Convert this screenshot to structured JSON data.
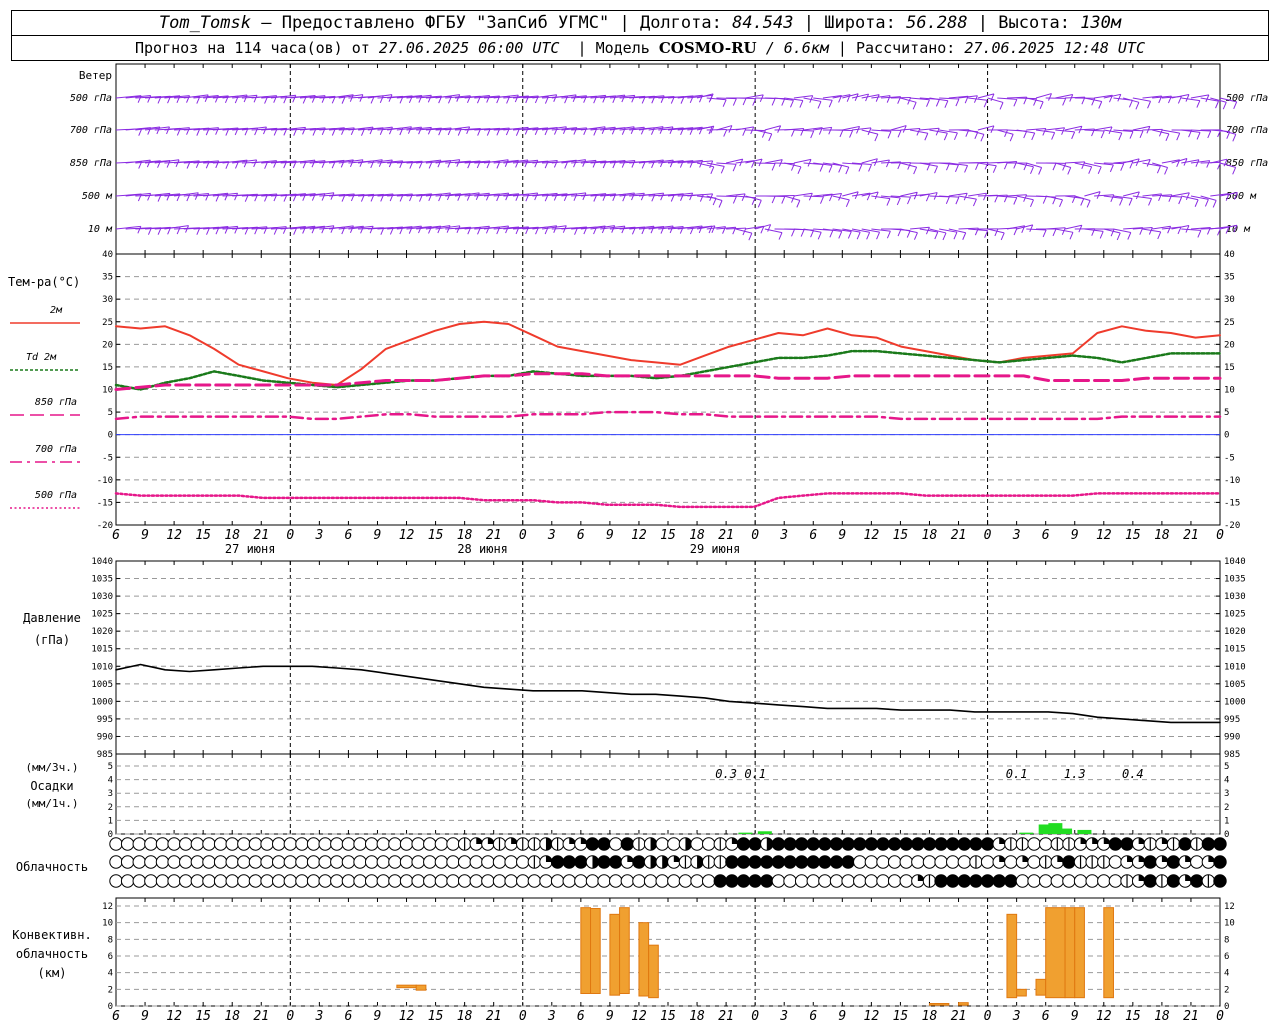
{
  "header": {
    "station": "Tom_Tomsk",
    "provider": "– Предоставлено ФГБУ \"ЗапСиб УГМС\"",
    "lon_label": "Долгота:",
    "lon": "84.543",
    "lat_label": "Широта:",
    "lat": "56.288",
    "alt_label": "Высота:",
    "alt": "130м",
    "forecast_prefix": "Прогноз на 114 часа(ов)  от",
    "issue_time": "27.06.2025 06:00 UTC",
    "model_label": "Модель",
    "model": "COSMO-RU",
    "resolution": "/ 6.6км",
    "calc_label": "Рассчитано:",
    "calc_time": "27.06.2025 12:48 UTC"
  },
  "chart_data": [
    {
      "type": "wind-barbs",
      "title": "Ветер",
      "levels": [
        "500 гПа",
        "700 гПа",
        "850 гПа",
        "500 м",
        "10  м"
      ],
      "color": "#8a2be2"
    },
    {
      "type": "line",
      "title": "Тем-ра(°С)",
      "ylim": [
        -20,
        40
      ],
      "yticks": [
        -20,
        -15,
        -10,
        -5,
        0,
        5,
        10,
        15,
        20,
        25,
        30,
        35,
        40
      ],
      "x_hours": [
        0,
        3,
        6,
        9,
        12,
        15,
        18,
        21,
        24,
        27,
        30,
        33,
        36,
        39,
        42,
        45,
        48,
        51,
        54,
        57,
        60,
        63,
        66,
        69,
        72,
        75,
        78,
        81,
        84,
        87,
        90,
        93,
        96,
        99,
        102,
        105,
        108,
        111,
        114
      ],
      "series": [
        {
          "name": "2м",
          "color": "#ef3b2c",
          "style": "solid",
          "values": [
            24,
            23.5,
            24,
            22,
            19,
            15.5,
            14,
            12.5,
            11.5,
            11,
            14.5,
            19,
            21,
            23,
            24.5,
            25,
            24.5,
            22,
            19.5,
            18.5,
            17.5,
            16.5,
            16,
            15.5,
            17.5,
            19.5,
            21,
            22.5,
            22,
            23.5,
            22,
            21.5,
            19.5,
            18.5,
            17.5,
            16.5,
            16,
            17,
            17.5,
            18,
            22.5,
            24,
            23,
            22.5,
            21.5,
            22
          ]
        },
        {
          "name": "Td  2м",
          "color": "#1a7a1a",
          "style": "dotted",
          "values": [
            11,
            10,
            11.5,
            12.5,
            14,
            13,
            12,
            11.5,
            11,
            10.5,
            11,
            11.5,
            12,
            12,
            12.5,
            13,
            13,
            14,
            13.5,
            13,
            13,
            13,
            12.5,
            13,
            14,
            15,
            16,
            17,
            17,
            17.5,
            18.5,
            18.5,
            18,
            17.5,
            17,
            16.5,
            16,
            16.5,
            17,
            17.5,
            17,
            16,
            17,
            18,
            18,
            18
          ]
        },
        {
          "name": "850  гПа",
          "color": "#e6178a",
          "style": "dashed",
          "values": [
            10,
            10.5,
            11,
            11,
            11,
            11,
            11,
            11,
            11,
            11,
            11.5,
            12,
            12,
            12,
            12.5,
            13,
            13,
            13.5,
            13.5,
            13.5,
            13,
            13,
            13,
            13,
            13,
            13,
            13,
            12.5,
            12.5,
            12.5,
            13,
            13,
            13,
            13,
            13,
            13,
            13,
            13,
            12,
            12,
            12,
            12,
            12.5,
            12.5,
            12.5,
            12.5
          ]
        },
        {
          "name": "700  гПа",
          "color": "#e6178a",
          "style": "dashdot",
          "values": [
            3.5,
            4,
            4,
            4,
            4,
            4,
            4,
            4,
            3.5,
            3.5,
            4,
            4.5,
            4.5,
            4,
            4,
            4,
            4,
            4.5,
            4.5,
            4.5,
            5,
            5,
            5,
            4.5,
            4.5,
            4,
            4,
            4,
            4,
            4,
            4,
            4,
            3.5,
            3.5,
            3.5,
            3.5,
            3.5,
            3.5,
            3.5,
            3.5,
            3.5,
            4,
            4,
            4,
            4,
            4
          ]
        },
        {
          "name": "500  гПа",
          "color": "#e6178a",
          "style": "dotted",
          "values": [
            -13,
            -13.5,
            -13.5,
            -13.5,
            -13.5,
            -13.5,
            -14,
            -14,
            -14,
            -14,
            -14,
            -14,
            -14,
            -14,
            -14,
            -14.5,
            -14.5,
            -14.5,
            -15,
            -15,
            -15.5,
            -15.5,
            -15.5,
            -16,
            -16,
            -16,
            -16,
            -14,
            -13.5,
            -13,
            -13,
            -13,
            -13,
            -13.5,
            -13.5,
            -13.5,
            -13.5,
            -13.5,
            -13.5,
            -13.5,
            -13,
            -13,
            -13,
            -13,
            -13,
            -13
          ]
        }
      ]
    },
    {
      "type": "line",
      "title": "Давление",
      "ylabel": "(гПа)",
      "ylim": [
        985,
        1040
      ],
      "yticks": [
        985,
        990,
        995,
        1000,
        1005,
        1010,
        1015,
        1020,
        1025,
        1030,
        1035,
        1040
      ],
      "series": [
        {
          "name": "",
          "color": "#000000",
          "values": [
            1009,
            1010.5,
            1009,
            1008.5,
            1009,
            1009.5,
            1010,
            1010,
            1010,
            1009.5,
            1009,
            1008,
            1007,
            1006,
            1005,
            1004,
            1003.5,
            1003,
            1003,
            1003,
            1002.5,
            1002,
            1002,
            1001.5,
            1001,
            1000,
            999.5,
            999,
            998.5,
            998,
            998,
            998,
            997.5,
            997.5,
            997.5,
            997,
            997,
            997,
            997,
            996.5,
            995.5,
            995,
            994.5,
            994,
            994,
            994
          ]
        }
      ]
    },
    {
      "type": "bar",
      "title": "Осадки",
      "ylabel_3h": "(мм/3ч.)",
      "ylabel_1h": "(мм/1ч.)",
      "ylim": [
        0,
        5
      ],
      "yticks": [
        0,
        1,
        2,
        3,
        4,
        5
      ],
      "color": "#22dd22",
      "totals": [
        {
          "hour": 63,
          "label": "0.3"
        },
        {
          "hour": 66,
          "label": "0.1"
        },
        {
          "hour": 93,
          "label": "0.1"
        },
        {
          "hour": 99,
          "label": "1.3"
        },
        {
          "hour": 105,
          "label": "0.4"
        }
      ],
      "bars": [
        {
          "hour": 65,
          "value": 0.1
        },
        {
          "hour": 67,
          "value": 0.2
        },
        {
          "hour": 94,
          "value": 0.1
        },
        {
          "hour": 96,
          "value": 0.7
        },
        {
          "hour": 97,
          "value": 0.8
        },
        {
          "hour": 98,
          "value": 0.4
        },
        {
          "hour": 100,
          "value": 0.3
        }
      ]
    },
    {
      "type": "cloud-symbols",
      "title": "Облачность",
      "rows": [
        "000000000000000000000000000000122121131224404130030012443444444444444444444421100112224421214144",
        "000000000000000000000000000000000000124443442433213114444444444400000000001020201241110224242024",
        "000000000000000000000000000000000000000000000000000044444000000000000214444444000000000124142414"
      ]
    },
    {
      "type": "bar",
      "title": "Конвективн.",
      "title2": "облачность",
      "ylabel": "(км)",
      "ylim": [
        0,
        12
      ],
      "yticks": [
        0,
        2,
        4,
        6,
        8,
        10,
        12
      ],
      "color": "#f0a030",
      "edge": "#e07810",
      "bars": [
        {
          "h0": 29,
          "h1": 31,
          "base": 2.2,
          "top": 2.5
        },
        {
          "h0": 31,
          "h1": 32,
          "base": 1.9,
          "top": 2.5
        },
        {
          "h0": 48,
          "h1": 49,
          "base": 1.5,
          "top": 11.8
        },
        {
          "h0": 49,
          "h1": 50,
          "base": 1.5,
          "top": 11.7
        },
        {
          "h0": 51,
          "h1": 52,
          "base": 1.3,
          "top": 11.0
        },
        {
          "h0": 52,
          "h1": 53,
          "base": 1.5,
          "top": 11.8
        },
        {
          "h0": 54,
          "h1": 55,
          "base": 1.2,
          "top": 10.0
        },
        {
          "h0": 55,
          "h1": 56,
          "base": 1.0,
          "top": 7.3
        },
        {
          "h0": 84,
          "h1": 86,
          "base": 0.1,
          "top": 0.3
        },
        {
          "h0": 87,
          "h1": 88,
          "base": 0.1,
          "top": 0.4
        },
        {
          "h0": 92,
          "h1": 93,
          "base": 1.0,
          "top": 11.0
        },
        {
          "h0": 93,
          "h1": 94,
          "base": 1.2,
          "top": 2.0
        },
        {
          "h0": 95,
          "h1": 96,
          "base": 1.3,
          "top": 3.2
        },
        {
          "h0": 96,
          "h1": 98,
          "base": 1.0,
          "top": 11.8
        },
        {
          "h0": 98,
          "h1": 99,
          "base": 1.0,
          "top": 11.8
        },
        {
          "h0": 99,
          "h1": 100,
          "base": 1.0,
          "top": 11.8
        },
        {
          "h0": 102,
          "h1": 103,
          "base": 1.0,
          "top": 11.8
        }
      ]
    }
  ],
  "x_axis": {
    "start_hour_utc": 6,
    "total_hours": 114,
    "day_labels": [
      {
        "hour": 12,
        "label": "27 июня"
      },
      {
        "hour": 36,
        "label": "28 июня"
      },
      {
        "hour": 60,
        "label": "29 июня"
      }
    ]
  },
  "colors": {
    "grid": "#999999",
    "wind": "#8a2be2",
    "t2m": "#ef3b2c",
    "td": "#1a7a1a",
    "upper": "#e6178a",
    "zero_line": "#3040ff"
  }
}
